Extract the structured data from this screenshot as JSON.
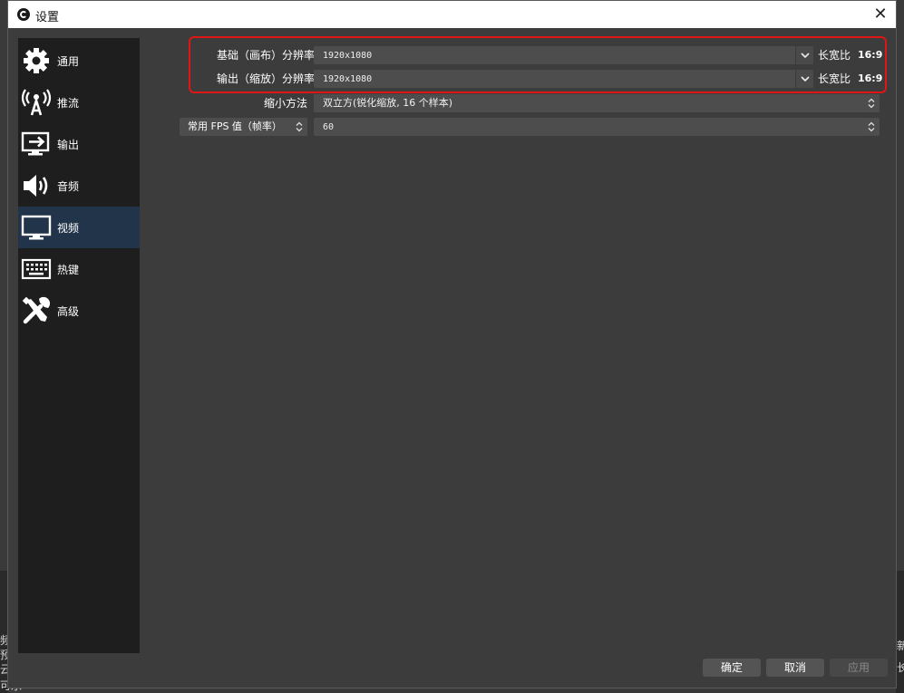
{
  "window": {
    "title": "设置",
    "close_glyph": "✕"
  },
  "sidebar": {
    "items": [
      {
        "label": "通用",
        "icon": "gear-icon"
      },
      {
        "label": "推流",
        "icon": "broadcast-icon"
      },
      {
        "label": "输出",
        "icon": "output-icon"
      },
      {
        "label": "音频",
        "icon": "speaker-icon"
      },
      {
        "label": "视频",
        "icon": "monitor-icon",
        "active": true
      },
      {
        "label": "热键",
        "icon": "keyboard-icon"
      },
      {
        "label": "高级",
        "icon": "tools-icon"
      }
    ]
  },
  "video": {
    "base_resolution": {
      "label": "基础（画布）分辨率",
      "value": "1920x1080",
      "aspect_label": "长宽比",
      "aspect_value": "16:9"
    },
    "output_resolution": {
      "label": "输出（缩放）分辨率",
      "value": "1920x1080",
      "aspect_label": "长宽比",
      "aspect_value": "16:9"
    },
    "downscale_filter": {
      "label": "缩小方法",
      "value": "双立方(锐化缩放, 16 个样本)"
    },
    "fps": {
      "mode_label": "常用 FPS 值（帧率）",
      "value": "60"
    }
  },
  "buttons": {
    "ok": "确定",
    "cancel": "取消",
    "apply": "应用"
  },
  "background": {
    "left_glyphs": [
      "频",
      "预",
      "云",
      "可乐"
    ],
    "right_glyphs": [
      "新",
      "长"
    ]
  },
  "colors": {
    "highlight": "#e01515",
    "active_item": "#22344a",
    "sidebar_bg": "#1e1e1e",
    "window_bg": "#3c3c3c"
  }
}
